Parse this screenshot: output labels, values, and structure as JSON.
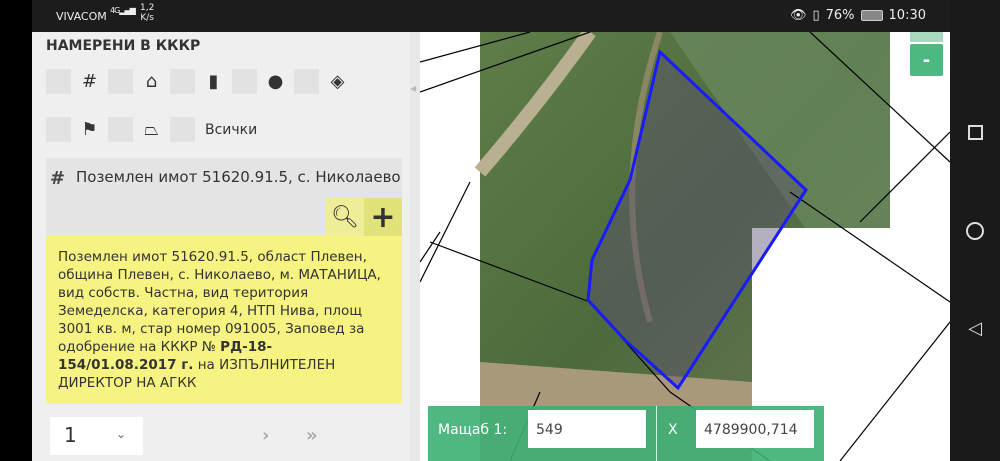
{
  "status_bar": {
    "carrier": "VIVACOM",
    "signal": "4G",
    "speed_value": "1,2",
    "speed_unit": "K/s",
    "battery": "76%",
    "time": "10:30"
  },
  "panel": {
    "title": "НАМЕРЕНИ В КККР",
    "filters": [
      "parcel-grid",
      "building",
      "apartment",
      "location-pin",
      "layers",
      "flag",
      "polygon"
    ],
    "all_label": "Всички",
    "result": {
      "title": "Поземлен имот 51620.91.5, с. Николаево",
      "info_plain": "Поземлен имот 51620.91.5, област Плевен, община Плевен, с. Николаево, м. МАТАНИЦА, вид собств. Частна, вид територия Земеделска, категория 4, НТП Нива, площ 3001 кв. м, стар номер 091005, Заповед за одобрение на КККР №",
      "info_bold": "РД-18-154/01.08.2017 г.",
      "info_tail": "на ИЗПЪЛНИТЕЛЕН ДИРЕКТОР НА АГКК"
    },
    "pager": {
      "page": "1",
      "next": "›",
      "last": "»"
    }
  },
  "map": {
    "zoom_out": "-",
    "scale_label": "Мащаб  1:",
    "scale_value": "549",
    "x_label": "X",
    "x_value": "4789900,714",
    "parcel_color": "#1a1aff",
    "accent": "#4cb882"
  }
}
